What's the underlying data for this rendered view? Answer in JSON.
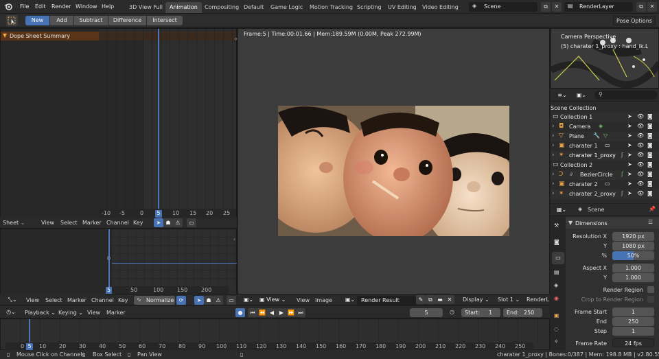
{
  "topbar": {
    "menus": [
      "File",
      "Edit",
      "Render",
      "Window",
      "Help"
    ],
    "workspaces": [
      "3D View Full",
      "Animation",
      "Compositing",
      "Default",
      "Game Logic",
      "Motion Tracking",
      "Scripting",
      "UV Editing",
      "Video Editing"
    ],
    "active_workspace": "Animation",
    "scene": "Scene",
    "render_layer": "RenderLayer"
  },
  "toolbar2": {
    "buttons": [
      "New",
      "Add",
      "Subtract",
      "Difference",
      "Intersect"
    ],
    "active": "New",
    "pose_options": "Pose Options"
  },
  "dopesheet": {
    "summary_label": "Dope Sheet Summary",
    "ruler": [
      "-10",
      "-5",
      "0",
      "5",
      "10",
      "15",
      "20",
      "25"
    ],
    "current_frame": "5",
    "header": {
      "mode": "Sheet",
      "menus": [
        "View",
        "Select",
        "Marker",
        "Channel",
        "Key"
      ]
    }
  },
  "graph_editor": {
    "ruler": [
      "0",
      "50",
      "100",
      "150",
      "200"
    ],
    "current_frame": "5",
    "y_label": "0",
    "header": {
      "menus": [
        "View",
        "Select",
        "Marker",
        "Channel",
        "Key"
      ],
      "normalize": "Normalize"
    }
  },
  "render_view": {
    "info": "Frame:5 | Time:00:01.66 | Mem:189.59M (0.00M, Peak 272.99M)",
    "header": {
      "view": "View",
      "menus": [
        "View",
        "Image"
      ],
      "image_name": "Render Result",
      "display": "Display",
      "slot": "Slot 1",
      "render_layer_short": "RenderL"
    }
  },
  "viewport_thumb": {
    "camera_label": "Camera Perspective",
    "object_label": "(5) charater 1_proxy : hand_ik.L"
  },
  "outliner": {
    "title": "Scene Collection",
    "rows": [
      {
        "label": "Collection 1",
        "indent": 0,
        "icon": "collection"
      },
      {
        "label": "Camera",
        "indent": 1,
        "icon": "camera"
      },
      {
        "label": "Plane",
        "indent": 1,
        "icon": "mesh"
      },
      {
        "label": "charater 1",
        "indent": 1,
        "icon": "armature"
      },
      {
        "label": "charater 1_proxy",
        "indent": 1,
        "icon": "armature-proxy"
      },
      {
        "label": "Collection 2",
        "indent": 0,
        "icon": "collection"
      },
      {
        "label": "BezierCircle",
        "indent": 1,
        "icon": "curve"
      },
      {
        "label": "charater 2",
        "indent": 1,
        "icon": "armature"
      },
      {
        "label": "charater 2_proxy",
        "indent": 1,
        "icon": "armature-proxy"
      }
    ]
  },
  "properties": {
    "scene_label": "Scene",
    "section": "Dimensions",
    "resolution_x_label": "Resolution X",
    "resolution_x": "1920 px",
    "y_label": "Y",
    "resolution_y": "1080 px",
    "percent_label": "%",
    "percent": "50%",
    "aspect_x_label": "Aspect X",
    "aspect_x": "1.000",
    "aspect_y_label": "Y",
    "aspect_y": "1.000",
    "render_region": "Render Region",
    "crop_region": "Crop to Render Region",
    "frame_start_label": "Frame Start",
    "frame_start": "1",
    "end_label": "End",
    "frame_end": "250",
    "step_label": "Step",
    "step": "1",
    "frame_rate_label": "Frame Rate",
    "frame_rate": "24 fps"
  },
  "timeline": {
    "menus": [
      "Playback",
      "Keying",
      "View",
      "Marker"
    ],
    "current_frame": "5",
    "start_label": "Start:",
    "start": "1",
    "end_label": "End:",
    "end": "250",
    "ruler": [
      "0",
      "5",
      "10",
      "20",
      "30",
      "40",
      "50",
      "60",
      "70",
      "80",
      "90",
      "100",
      "110",
      "120",
      "130",
      "140",
      "150",
      "160",
      "170",
      "180",
      "190",
      "200",
      "210",
      "220",
      "230",
      "240",
      "250"
    ]
  },
  "statusbar": {
    "left1": "Mouse Click on Channels",
    "left2": "Box Select",
    "left3": "Pan View",
    "right": "charater 1_proxy | Bones:0/387 | Mem: 198.8 MB | v2.80.55"
  },
  "colors": {
    "accent": "#4772b3",
    "summary_bar": "#5a3418",
    "panel": "#303030"
  }
}
